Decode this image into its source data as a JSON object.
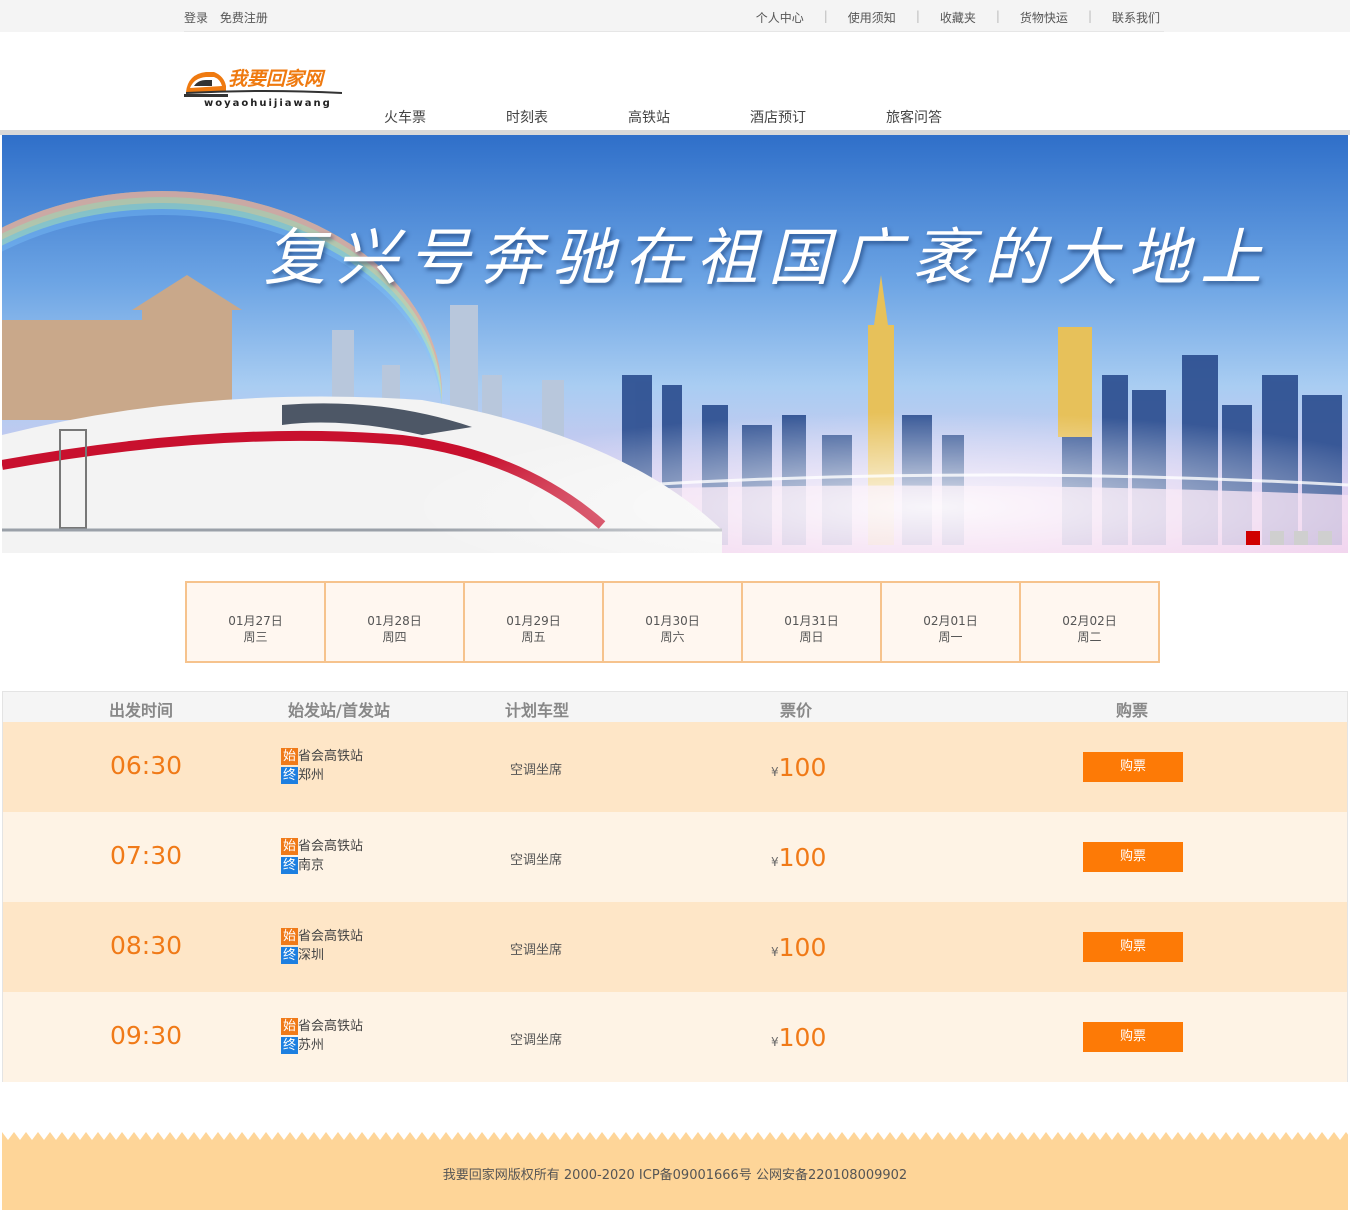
{
  "topbar": {
    "login": "登录",
    "register": "免费注册",
    "links": [
      "个人中心",
      "使用须知",
      "收藏夹",
      "货物快运",
      "联系我们"
    ]
  },
  "logo": {
    "cn": "我要回家网",
    "en": "woyaohuijiawang"
  },
  "nav": [
    "火车票",
    "时刻表",
    "高铁站",
    "酒店预订",
    "旅客问答"
  ],
  "banner": {
    "slogan": "复兴号奔驰在祖国广袤的大地上",
    "slide_count": 4,
    "active_slide": 1
  },
  "dates": [
    {
      "date": "01月27日",
      "weekday": "周三"
    },
    {
      "date": "01月28日",
      "weekday": "周四"
    },
    {
      "date": "01月29日",
      "weekday": "周五"
    },
    {
      "date": "01月30日",
      "weekday": "周六"
    },
    {
      "date": "01月31日",
      "weekday": "周日"
    },
    {
      "date": "02月01日",
      "weekday": "周一"
    },
    {
      "date": "02月02日",
      "weekday": "周二"
    }
  ],
  "table": {
    "headers": [
      "出发时间",
      "始发站/首发站",
      "计划车型",
      "票价",
      "购票"
    ],
    "start_tag": "始",
    "end_tag": "终",
    "rows": [
      {
        "time": "06:30",
        "from": "省会高铁站",
        "to": "郑州",
        "type": "空调坐席",
        "currency": "¥",
        "price": "100",
        "button": "购票"
      },
      {
        "time": "07:30",
        "from": "省会高铁站",
        "to": "南京",
        "type": "空调坐席",
        "currency": "¥",
        "price": "100",
        "button": "购票"
      },
      {
        "time": "08:30",
        "from": "省会高铁站",
        "to": "深圳",
        "type": "空调坐席",
        "currency": "¥",
        "price": "100",
        "button": "购票"
      },
      {
        "time": "09:30",
        "from": "省会高铁站",
        "to": "苏州",
        "type": "空调坐席",
        "currency": "¥",
        "price": "100",
        "button": "购票"
      }
    ]
  },
  "footer": {
    "text": "我要回家网版权所有 2000-2020 ICP备09001666号  公网安备220108009902"
  },
  "colors": {
    "accent": "#f07a18",
    "button": "#fd7a06",
    "end_tag": "#1d7fe0",
    "active_dot": "#d00000",
    "footer_bg": "#fed598"
  }
}
